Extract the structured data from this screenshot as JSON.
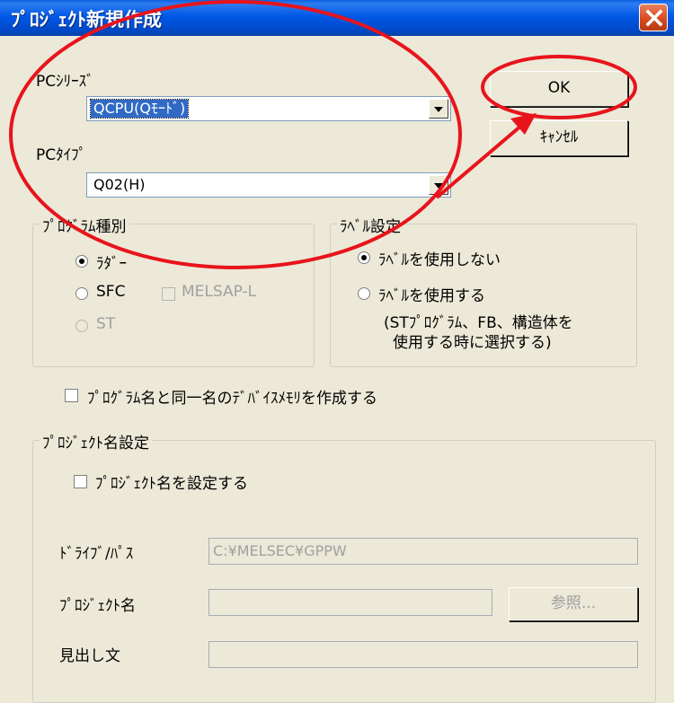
{
  "dialog": {
    "title": "ﾌﾟﾛｼﾞｪｸﾄ新規作成"
  },
  "pc_series": {
    "label": "PCｼﾘｰｽﾞ",
    "value": "QCPU(Qﾓｰﾄﾞ)"
  },
  "pc_type": {
    "label": "PCﾀｲﾌﾟ",
    "value": "Q02(H)"
  },
  "buttons": {
    "ok": "OK",
    "cancel": "ｷｬﾝｾﾙ",
    "browse": "参照..."
  },
  "program_type": {
    "title": "ﾌﾟﾛｸﾞﾗﾑ種別",
    "ladder": "ﾗﾀﾞｰ",
    "sfc": "SFC",
    "melsap": "MELSAP-L",
    "st": "ST"
  },
  "label_setting": {
    "title": "ﾗﾍﾞﾙ設定",
    "no_label": "ﾗﾍﾞﾙを使用しない",
    "use_label": "ﾗﾍﾞﾙを使用する",
    "note_line1": "(STﾌﾟﾛｸﾞﾗﾑ、FB、構造体を",
    "note_line2": "使用する時に選択する)"
  },
  "device_memory_check": "ﾌﾟﾛｸﾞﾗﾑ名と同一名のﾃﾞﾊﾞｲｽﾒﾓﾘを作成する",
  "project_name_setting": {
    "title": "ﾌﾟﾛｼﾞｪｸﾄ名設定",
    "set_name_check": "ﾌﾟﾛｼﾞｪｸﾄ名を設定する",
    "drive_path_label": "ﾄﾞﾗｲﾌﾞ/ﾊﾟｽ",
    "drive_path_value": "C:¥MELSEC¥GPPW",
    "project_name_label": "ﾌﾟﾛｼﾞｪｸﾄ名",
    "project_name_value": "",
    "heading_label": "見出し文",
    "heading_value": ""
  },
  "colors": {
    "titlebar": "#0054e3",
    "annotation": "#e8141c",
    "face": "#ece9d8"
  }
}
